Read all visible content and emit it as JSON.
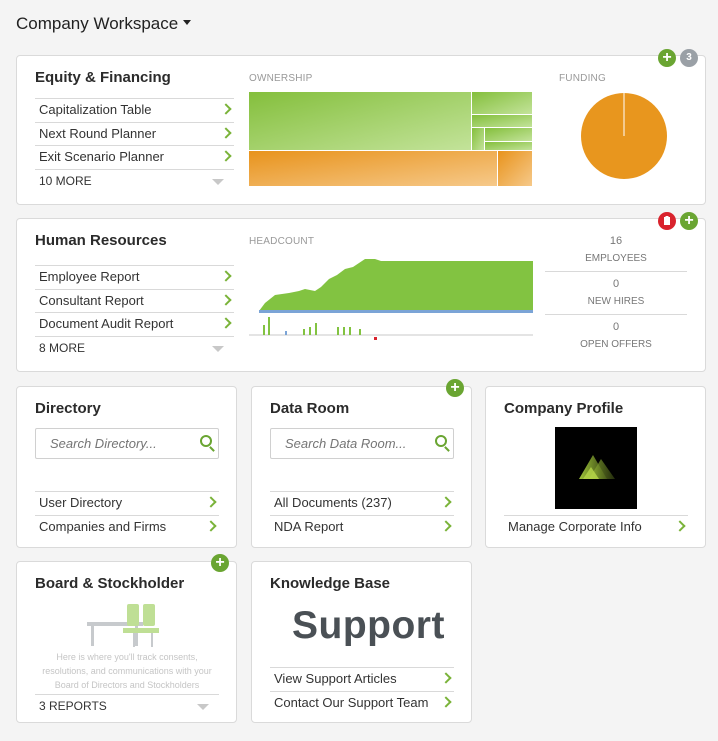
{
  "workspace": {
    "title": "Company Workspace"
  },
  "equity": {
    "title": "Equity & Financing",
    "links": [
      "Capitalization Table",
      "Next Round Planner",
      "Exit Scenario Planner"
    ],
    "more": "10 MORE",
    "ownership_label": "OWNERSHIP",
    "funding_label": "FUNDING",
    "badge_count": "3",
    "colors": {
      "green": "#8cc540",
      "orange": "#e8961e"
    }
  },
  "hr": {
    "title": "Human Resources",
    "links": [
      "Employee Report",
      "Consultant Report",
      "Document Audit Report"
    ],
    "more": "8 MORE",
    "headcount_label": "HEADCOUNT",
    "stats": [
      {
        "value": "16",
        "label": "EMPLOYEES"
      },
      {
        "value": "0",
        "label": "NEW HIRES"
      },
      {
        "value": "0",
        "label": "OPEN OFFERS"
      }
    ]
  },
  "directory": {
    "title": "Directory",
    "search_placeholder": "Search Directory...",
    "links": [
      "User Directory",
      "Companies and Firms"
    ]
  },
  "dataroom": {
    "title": "Data Room",
    "search_placeholder": "Search Data Room...",
    "links": [
      "All Documents (237)",
      "NDA Report"
    ]
  },
  "profile": {
    "title": "Company Profile",
    "links": [
      "Manage Corporate Info"
    ]
  },
  "board": {
    "title": "Board & Stockholder",
    "note": "Here is where you'll track consents, resolutions, and communications with your Board of Directors and Stockholders",
    "more": "3 REPORTS"
  },
  "knowledge": {
    "title": "Knowledge Base",
    "big_word": "Support",
    "links": [
      "View Support Articles",
      "Contact Our Support Team"
    ]
  },
  "icons": [
    "plus-icon",
    "clipboard-icon",
    "search-icon",
    "chevron-right-icon",
    "caret-down-icon"
  ]
}
